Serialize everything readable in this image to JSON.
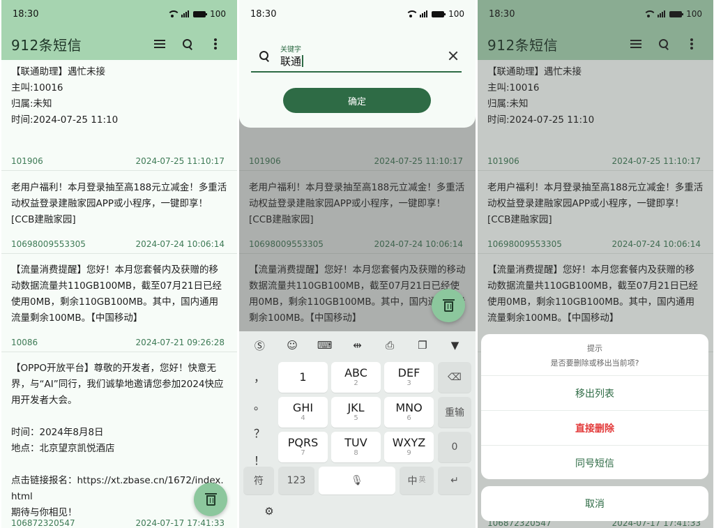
{
  "status": {
    "time": "18:30",
    "battery": "100"
  },
  "appbar": {
    "title": "912条短信"
  },
  "messages": [
    {
      "body": "【联通助理】遇忙未接\n主叫:10016\n归属:未知\n时间:2024-07-25 11:10",
      "sender": "101906",
      "time": "2024-07-25 11:10:17"
    },
    {
      "body": "老用户福利！本月登录抽至高188元立减金！多重活动权益登录建融家园APP或小程序，一键即享！[CCB建融家园]",
      "sender": "10698009553305",
      "time": "2024-07-24 10:06:14"
    },
    {
      "body": "【流量消费提醒】您好！本月您套餐内及获赠的移动数据流量共110GB100MB，截至07月21日已经使用0MB，剩余110GB100MB。其中，国内通用流量剩余100MB。【中国移动】",
      "sender": "10086",
      "time": "2024-07-21 09:26:28"
    },
    {
      "body": "【OPPO开放平台】尊敬的开发者，您好！快意无界，与“AI”同行，我们诚挚地邀请您参加2024快应用开发者大会。\n\n时间：2024年8月8日\n地点：北京望京凯悦酒店\n\n点击链接报名：https://xt.zbase.cn/1672/index.html\n期待与你相见！",
      "sender": "106872320547",
      "time": "2024-07-17 17:41:33"
    }
  ],
  "search": {
    "label": "关键字",
    "value": "联通",
    "confirm": "确定"
  },
  "keyboard": {
    "left": [
      "，",
      "。",
      "？",
      "！"
    ],
    "keys": [
      {
        "big": "1",
        "sm": ""
      },
      {
        "big": "ABC",
        "sm": "2"
      },
      {
        "big": "DEF",
        "sm": "3"
      },
      {
        "big": "GHI",
        "sm": "4"
      },
      {
        "big": "JKL",
        "sm": "5"
      },
      {
        "big": "MNO",
        "sm": "6"
      },
      {
        "big": "PQRS",
        "sm": "7"
      },
      {
        "big": "TUV",
        "sm": "8"
      },
      {
        "big": "WXYZ",
        "sm": "9"
      }
    ],
    "reinput": "重输",
    "zero": "0",
    "symbol": "符",
    "num": "123",
    "lang": "中",
    "lang_alt": "英"
  },
  "dialog": {
    "title": "提示",
    "message": "是否要删除或移出当前项?",
    "options": [
      "移出列表",
      "直接删除",
      "同号短信"
    ],
    "cancel": "取消"
  },
  "colors": {
    "header": "#a6d4b0",
    "accent": "#2e6b45",
    "danger": "#e33b3b",
    "fab": "#8cc79d"
  }
}
